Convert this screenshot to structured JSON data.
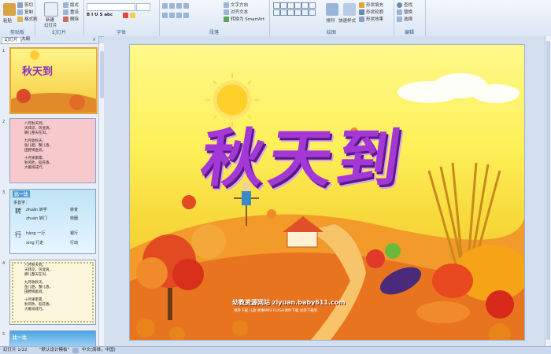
{
  "ribbon": {
    "groups": {
      "clipboard": "剪贴板",
      "slides": "幻灯片",
      "font": "字体",
      "paragraph": "段落",
      "drawing": "绘图",
      "editing": "编辑"
    },
    "clipboard": {
      "paste": "粘贴",
      "cut": "剪切",
      "copy": "复制",
      "format_painter": "格式刷"
    },
    "slides": {
      "new_slide": "新建",
      "new_slide2": "幻灯片",
      "layout": "版式",
      "reset": "重设",
      "delete": "删除"
    },
    "paragraph": {
      "text_direction": "文字方向",
      "align_text": "对齐文本",
      "smartart": "转换为 SmartArt"
    },
    "drawing": {
      "arrange": "排列",
      "quick_styles": "快速样式",
      "shape_fill": "形状填充",
      "shape_outline": "形状轮廓",
      "shape_effects": "形状效果"
    },
    "editing": {
      "find": "查找",
      "replace": "替换",
      "select": "选择"
    }
  },
  "left_panel": {
    "tabs": {
      "slides": "幻灯片",
      "outline": "大纲"
    },
    "close": "×",
    "thumbnails": [
      {
        "num": "1",
        "title": "秋天到"
      },
      {
        "num": "2",
        "lines": [
          "八月秋天到，",
          "天转凉，风变爽，",
          "蝉儿整天在叫，",
          "",
          "九月收秋天，",
          "鱼儿肥，蟹儿香，",
          "田野揭金浪，",
          "",
          "十月果累累，",
          "秋风吹，稻花香，",
          "大雁排成行。"
        ]
      },
      {
        "num": "3",
        "heading": "比一比",
        "sub": "多音字：",
        "rows": [
          {
            "char": "转",
            "a": "zhuǎn 转学",
            "b": "转变"
          },
          {
            "char": "",
            "a": "zhuàn 转门",
            "b": "转圈"
          },
          {
            "char": "行",
            "a": "háng 一行",
            "b": "银行"
          },
          {
            "char": "",
            "a": "xíng 行走",
            "b": "行动"
          }
        ]
      },
      {
        "num": "4",
        "lines": [
          "八月秋天到，",
          "天转凉，风变爽，",
          "蝉儿整天在叫，",
          "",
          "九月收秋天，",
          "鱼儿肥，蟹儿香，",
          "田野揭金浪，",
          "",
          "十月果累累，",
          "秋风吹，稻花香，",
          "大雁排成行。"
        ]
      },
      {
        "num": "5",
        "heading": "比一比"
      }
    ]
  },
  "slide": {
    "title": "秋天到",
    "watermark1": "幼教资源网站  ziyuan.baby611.com",
    "watermark2": "课件下载  儿歌  故事MP3  FLASH课件下载  试卷下载等"
  },
  "status": {
    "slide_info": "幻灯片 1/22",
    "theme": "\"默认设计模板\"",
    "lang": "中文(简体，中国)"
  }
}
